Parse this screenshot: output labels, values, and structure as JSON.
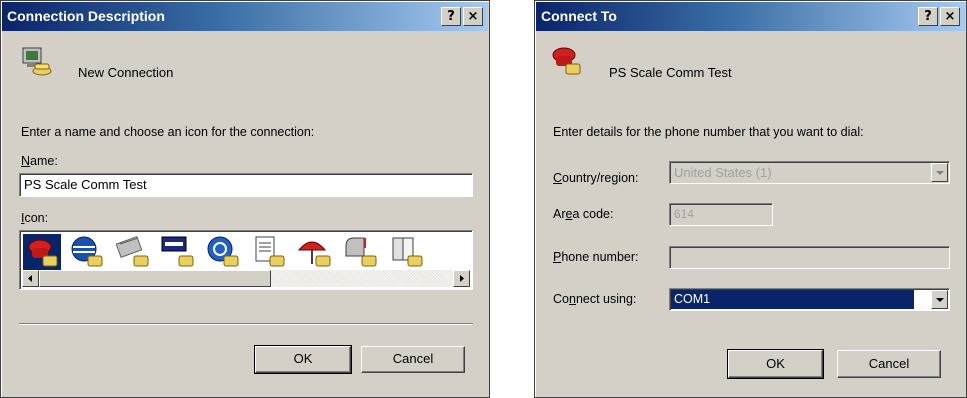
{
  "connection_description": {
    "title": "Connection Description",
    "help_glyph": "?",
    "close_glyph": "×",
    "header_icon": "phone-computer-icon",
    "header_label": "New Connection",
    "instruction": "Enter a name and choose an icon for the connection:",
    "name_label_u": "N",
    "name_label_rest": "ame:",
    "name_value": "PS Scale Comm Test",
    "icon_label_u": "I",
    "icon_label_rest": "con:",
    "icons": [
      "red-phone-icon",
      "globe-phone-icon",
      "satellite-phone-icon",
      "mci-phone-icon",
      "ge-globe-phone-icon",
      "document-phone-icon",
      "umbrella-phone-icon",
      "mailbox-phone-icon",
      "book-phone-icon"
    ],
    "selected_icon_index": 0,
    "ok_label": "OK",
    "cancel_label": "Cancel"
  },
  "connect_to": {
    "title": "Connect To",
    "help_glyph": "?",
    "close_glyph": "×",
    "header_icon": "red-phone-icon",
    "header_label": "PS Scale Comm Test",
    "instruction": "Enter details for the phone number that you want to dial:",
    "country_label_u": "C",
    "country_label_rest": "ountry/region:",
    "country_value": "United States (1)",
    "area_label_pre": "Ar",
    "area_label_u": "e",
    "area_label_rest": "a code:",
    "area_value": "614",
    "phone_label_u": "P",
    "phone_label_rest": "hone number:",
    "phone_value": "",
    "connect_label_pre": "Co",
    "connect_label_u": "n",
    "connect_label_rest": "nect using:",
    "connect_value": "COM1",
    "ok_label": "OK",
    "cancel_label": "Cancel"
  },
  "colors": {
    "titlebar_start": "#0a246a",
    "titlebar_end": "#a6caf0",
    "window_face": "#d4d0c8",
    "selection": "#0a246a"
  }
}
